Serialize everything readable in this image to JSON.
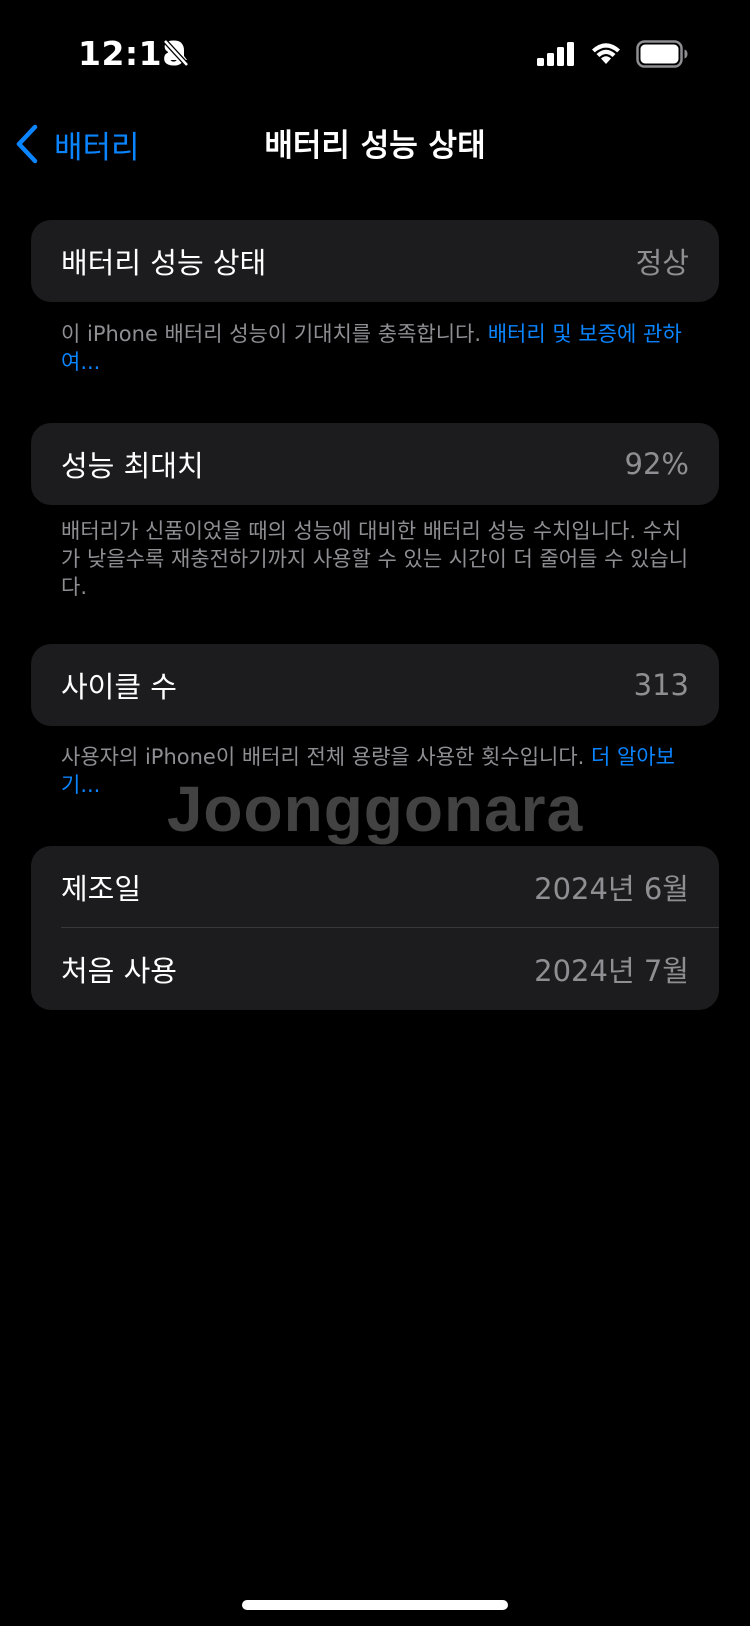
{
  "status_bar": {
    "time": "12:18",
    "icons": [
      "bell-slash-icon",
      "cellular-signal-icon",
      "wifi-icon",
      "battery-icon"
    ]
  },
  "nav": {
    "back_label": "배터리",
    "title": "배터리 성능 상태"
  },
  "health": {
    "label": "배터리 성능 상태",
    "value": "정상",
    "footnote": "이 iPhone 배터리 성능이 기대치를 충족합니다. ",
    "footnote_link": "배터리 및 보증에 관하여..."
  },
  "capacity": {
    "label": "성능 최대치",
    "value": "92%",
    "footnote": "배터리가 신품이었을 때의 성능에 대비한 배터리 성능 수치입니다. 수치가 낮을수록 재충전하기까지 사용할 수 있는 시간이 더 줄어들 수 있습니다."
  },
  "cycles": {
    "label": "사이클 수",
    "value": "313",
    "footnote": "사용자의 iPhone이 배터리 전체 용량을 사용한 횟수입니다. ",
    "footnote_link": "더 알아보기..."
  },
  "dates": {
    "manufacture_label": "제조일",
    "manufacture_value": "2024년 6월",
    "first_use_label": "처음 사용",
    "first_use_value": "2024년 7월"
  },
  "watermark": "Joonggonara",
  "colors": {
    "accent": "#0a84ff",
    "background": "#000000",
    "cell": "#1c1c1e",
    "secondary_text": "#8e8e93"
  }
}
